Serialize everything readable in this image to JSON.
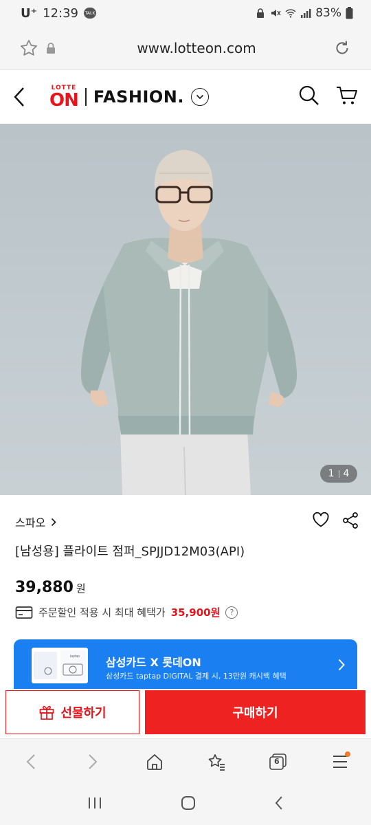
{
  "status": {
    "carrier": "U⁺",
    "time": "12:39",
    "talk": "TALK",
    "battery": "83%"
  },
  "browser": {
    "url": "www.lotteon.com"
  },
  "header": {
    "logo_small": "LOTTE",
    "logo_big": "ON",
    "brand": "FASHION."
  },
  "gallery": {
    "current": "1",
    "total": "4"
  },
  "product": {
    "shop": "스파오",
    "title": "[남성용] 플라이트 점퍼_SPJJD12M03(API)",
    "price": "39,880",
    "currency": "원",
    "discount_text": "주문할인 적용 시 최대 혜택가",
    "discount_price": "35,900원"
  },
  "promo": {
    "title": "삼성카드 X 롯데ON",
    "subtitle": "삼성카드 taptap DIGITAL 결제 시, 13만원 캐시백 혜택",
    "card_label": "taptap"
  },
  "actions": {
    "gift": "선물하기",
    "buy": "구매하기"
  },
  "browser_nav": {
    "tabs_count": "6"
  },
  "colors": {
    "accent": "#e8141b",
    "buy": "#ee2321",
    "promo": "#1a7ff0"
  }
}
